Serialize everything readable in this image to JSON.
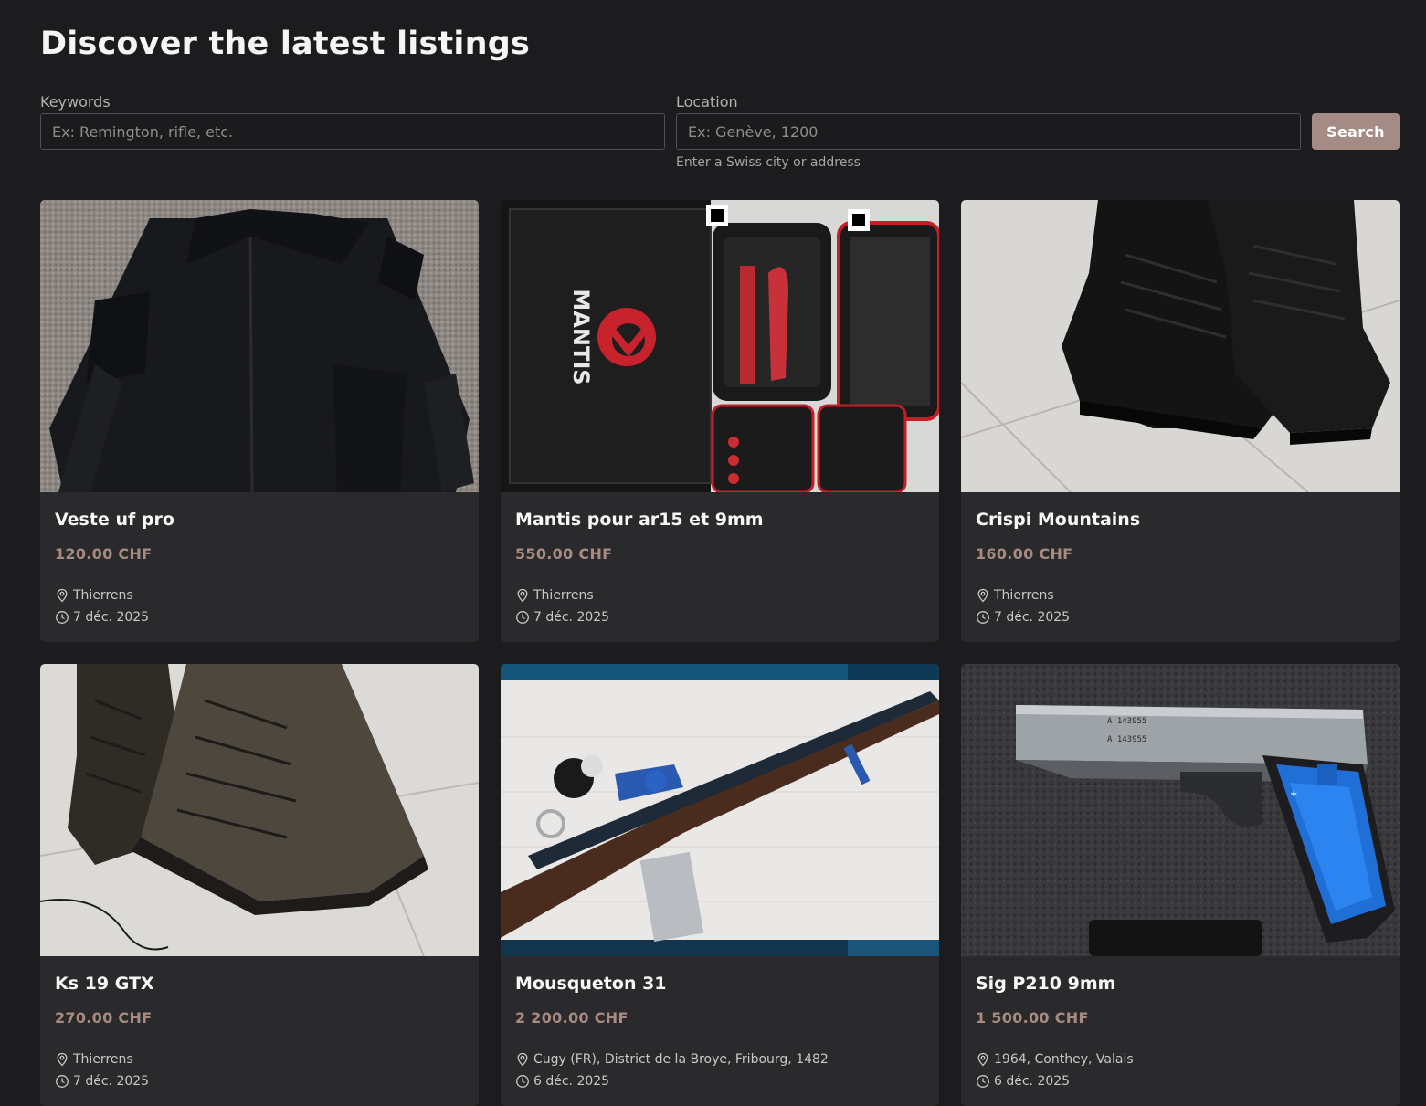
{
  "header": {
    "title": "Discover the latest listings"
  },
  "search": {
    "keywords_label": "Keywords",
    "keywords_placeholder": "Ex: Remington, rifle, etc.",
    "location_label": "Location",
    "location_placeholder": "Ex: Genève, 1200",
    "location_hint": "Enter a Swiss city or address",
    "button_label": "Search"
  },
  "colors": {
    "page_bg": "#1c1c1e",
    "card_bg": "#2a2a2c",
    "accent": "#a58b85",
    "price": "#a88b80"
  },
  "listings": [
    {
      "title": "Veste uf pro",
      "price": "120.00 CHF",
      "location": "Thierrens",
      "date": "7 déc. 2025",
      "image": "black-jacket-photo"
    },
    {
      "title": "Mantis pour ar15 et 9mm",
      "price": "550.00 CHF",
      "location": "Thierrens",
      "date": "7 déc. 2025",
      "image": "mantis-training-kit-photo"
    },
    {
      "title": "Crispi Mountains",
      "price": "160.00 CHF",
      "location": "Thierrens",
      "date": "7 déc. 2025",
      "image": "black-boots-photo"
    },
    {
      "title": "Ks 19 GTX",
      "price": "270.00 CHF",
      "location": "Thierrens",
      "date": "7 déc. 2025",
      "image": "brown-boots-photo"
    },
    {
      "title": "Mousqueton 31",
      "price": "2 200.00 CHF",
      "location": "Cugy (FR), District de la Broye, Fribourg, 1482",
      "date": "6 déc. 2025",
      "image": "rifle-photo"
    },
    {
      "title": "Sig P210 9mm",
      "price": "1 500.00 CHF",
      "location": "1964, Conthey, Valais",
      "date": "6 déc. 2025",
      "image": "pistol-photo"
    }
  ]
}
